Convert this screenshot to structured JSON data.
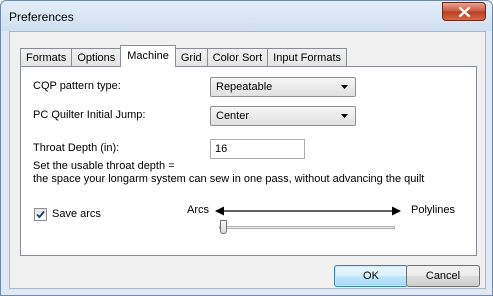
{
  "window": {
    "title": "Preferences"
  },
  "tabs": [
    {
      "label": "Formats",
      "active": false
    },
    {
      "label": "Options",
      "active": false
    },
    {
      "label": "Machine",
      "active": true
    },
    {
      "label": "Grid",
      "active": false
    },
    {
      "label": "Color Sort",
      "active": false
    },
    {
      "label": "Input Formats",
      "active": false
    }
  ],
  "machine": {
    "cqp_pattern_type": {
      "label": "CQP pattern type:",
      "value": "Repeatable"
    },
    "initial_jump": {
      "label": "PC Quilter Initial Jump:",
      "value": "Center"
    },
    "throat_depth": {
      "label": "Throat Depth (in):",
      "value": "16"
    },
    "help_line1": "Set the usable throat depth =",
    "help_line2": "the space your longarm system can sew in one pass, without advancing the quilt",
    "save_arcs": {
      "label": "Save arcs",
      "checked": true
    },
    "slider": {
      "left_label": "Arcs",
      "right_label": "Polylines",
      "value": 0
    }
  },
  "buttons": {
    "ok": "OK",
    "cancel": "Cancel"
  }
}
